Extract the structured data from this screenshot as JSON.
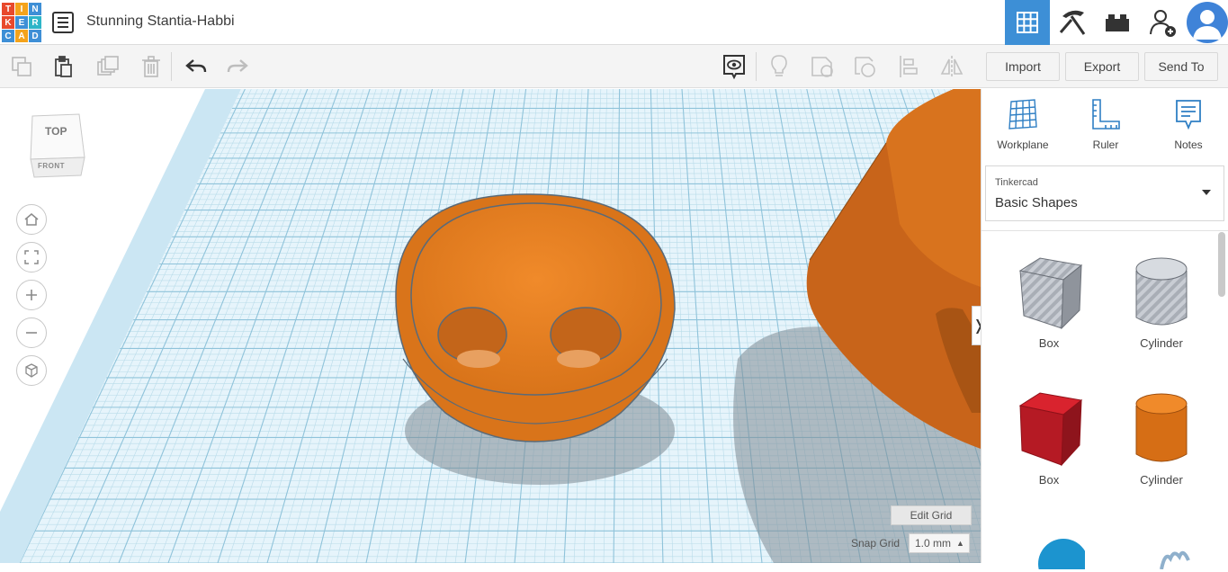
{
  "app": {
    "logo_letters": [
      "T",
      "I",
      "N",
      "K",
      "E",
      "R",
      "C",
      "A",
      "D"
    ],
    "logo_colors": [
      "#e8492c",
      "#f4a31b",
      "#3e8fd6",
      "#e8492c",
      "#3e8fd6",
      "#2db5c8",
      "#3e8fd6",
      "#f4a31b",
      "#3e8fd6"
    ],
    "title": "Stunning Stantia-Habbi"
  },
  "header_buttons": [
    {
      "name": "3d-design-grid-icon",
      "active": true
    },
    {
      "name": "codeblocks-pickaxe-icon",
      "active": false
    },
    {
      "name": "bricks-icon",
      "active": false
    },
    {
      "name": "add-user-icon",
      "active": false
    }
  ],
  "toolbar": {
    "import_label": "Import",
    "export_label": "Export",
    "send_to_label": "Send To"
  },
  "viewcube": {
    "top": "TOP",
    "front": "FRONT"
  },
  "canvas": {
    "edit_grid_label": "Edit Grid",
    "snap_grid_label": "Snap Grid",
    "snap_grid_value": "1.0 mm",
    "shape_color": "#e07b1f"
  },
  "panel": {
    "tools": [
      {
        "label": "Workplane",
        "icon": "workplane-icon"
      },
      {
        "label": "Ruler",
        "icon": "ruler-icon"
      },
      {
        "label": "Notes",
        "icon": "notes-icon"
      }
    ],
    "library_source": "Tinkercad",
    "library_name": "Basic Shapes",
    "shapes": [
      {
        "label": "Box",
        "kind": "box-hole"
      },
      {
        "label": "Cylinder",
        "kind": "cylinder-hole"
      },
      {
        "label": "Box",
        "kind": "box-solid"
      },
      {
        "label": "Cylinder",
        "kind": "cylinder-solid"
      }
    ]
  }
}
